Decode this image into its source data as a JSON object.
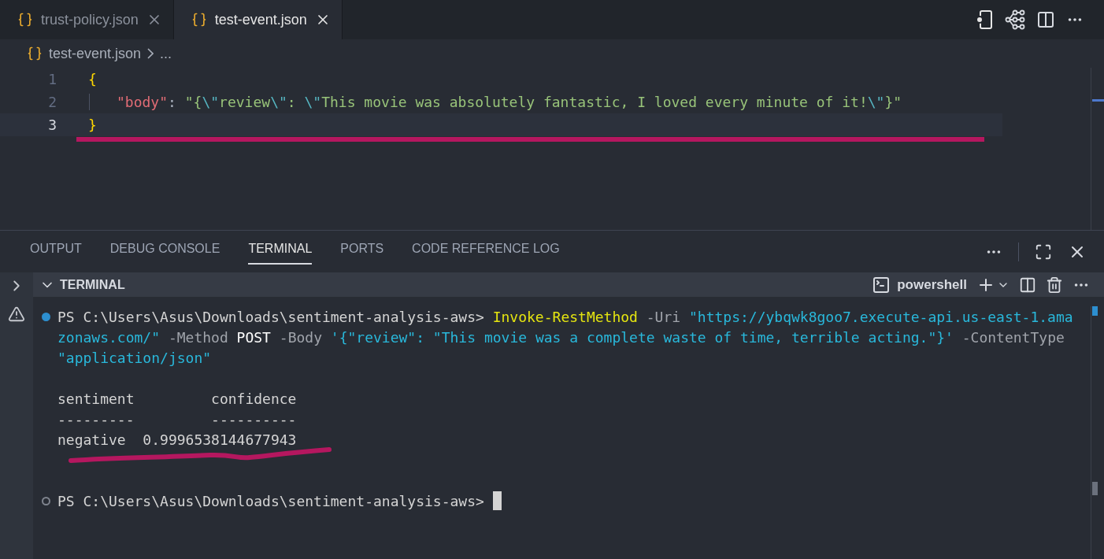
{
  "tabs": [
    {
      "label": "trust-policy.json",
      "selected": false
    },
    {
      "label": "test-event.json",
      "selected": true
    }
  ],
  "breadcrumb": {
    "file": "test-event.json",
    "more": "..."
  },
  "editor": {
    "lines": [
      {
        "number": "1",
        "current": false,
        "indented": false,
        "tokens": [
          {
            "kind": "brace",
            "text": "{"
          }
        ]
      },
      {
        "number": "2",
        "current": false,
        "indented": true,
        "tokens": [
          {
            "kind": "key",
            "text": "\"body\""
          },
          {
            "kind": "punct",
            "text": ": "
          },
          {
            "kind": "string",
            "text": "\"{"
          },
          {
            "kind": "escape",
            "text": "\\\""
          },
          {
            "kind": "string",
            "text": "review"
          },
          {
            "kind": "escape",
            "text": "\\\""
          },
          {
            "kind": "string",
            "text": ": "
          },
          {
            "kind": "escape",
            "text": "\\\""
          },
          {
            "kind": "string",
            "text": "This movie was absolutely fantastic, I loved every minute of it!"
          },
          {
            "kind": "escape",
            "text": "\\\""
          },
          {
            "kind": "string",
            "text": "}\""
          }
        ]
      },
      {
        "number": "3",
        "current": true,
        "indented": false,
        "tokens": [
          {
            "kind": "brace",
            "text": "}"
          }
        ]
      }
    ]
  },
  "panel": {
    "tabs": [
      {
        "label": "OUTPUT",
        "selected": false
      },
      {
        "label": "DEBUG CONSOLE",
        "selected": false
      },
      {
        "label": "TERMINAL",
        "selected": true
      },
      {
        "label": "PORTS",
        "selected": false
      },
      {
        "label": "CODE REFERENCE LOG",
        "selected": false
      }
    ],
    "terminal": {
      "title": "TERMINAL",
      "shell": "powershell",
      "entries": [
        {
          "kind": "command",
          "finished": true,
          "lines": [
            [
              {
                "kind": "prompt",
                "text": "PS C:\\Users\\Asus\\Downloads\\sentiment-analysis-aws> "
              },
              {
                "kind": "cmdlet",
                "text": "Invoke-RestMethod"
              },
              {
                "kind": "param",
                "text": " -Uri "
              },
              {
                "kind": "string",
                "text": "\"https://ybqwk8goo7.execute-api.us-east-1.ama"
              }
            ],
            [
              {
                "kind": "string",
                "text": "zonaws.com/\""
              },
              {
                "kind": "param",
                "text": " -Method "
              },
              {
                "kind": "plain",
                "text": "POST"
              },
              {
                "kind": "param",
                "text": " -Body "
              },
              {
                "kind": "string",
                "text": "'{\"review\": \"This movie was a complete waste of time, terrible acting.\"}'"
              },
              {
                "kind": "param",
                "text": " -ContentType"
              }
            ],
            [
              {
                "kind": "string",
                "text": "\"application/json\""
              }
            ]
          ]
        },
        {
          "kind": "output",
          "lines": [
            "sentiment         confidence",
            "---------         ----------",
            "negative  0.9996538144677943"
          ]
        },
        {
          "kind": "prompt",
          "finished": false,
          "text": "PS C:\\Users\\Asus\\Downloads\\sentiment-analysis-aws> "
        }
      ]
    }
  }
}
